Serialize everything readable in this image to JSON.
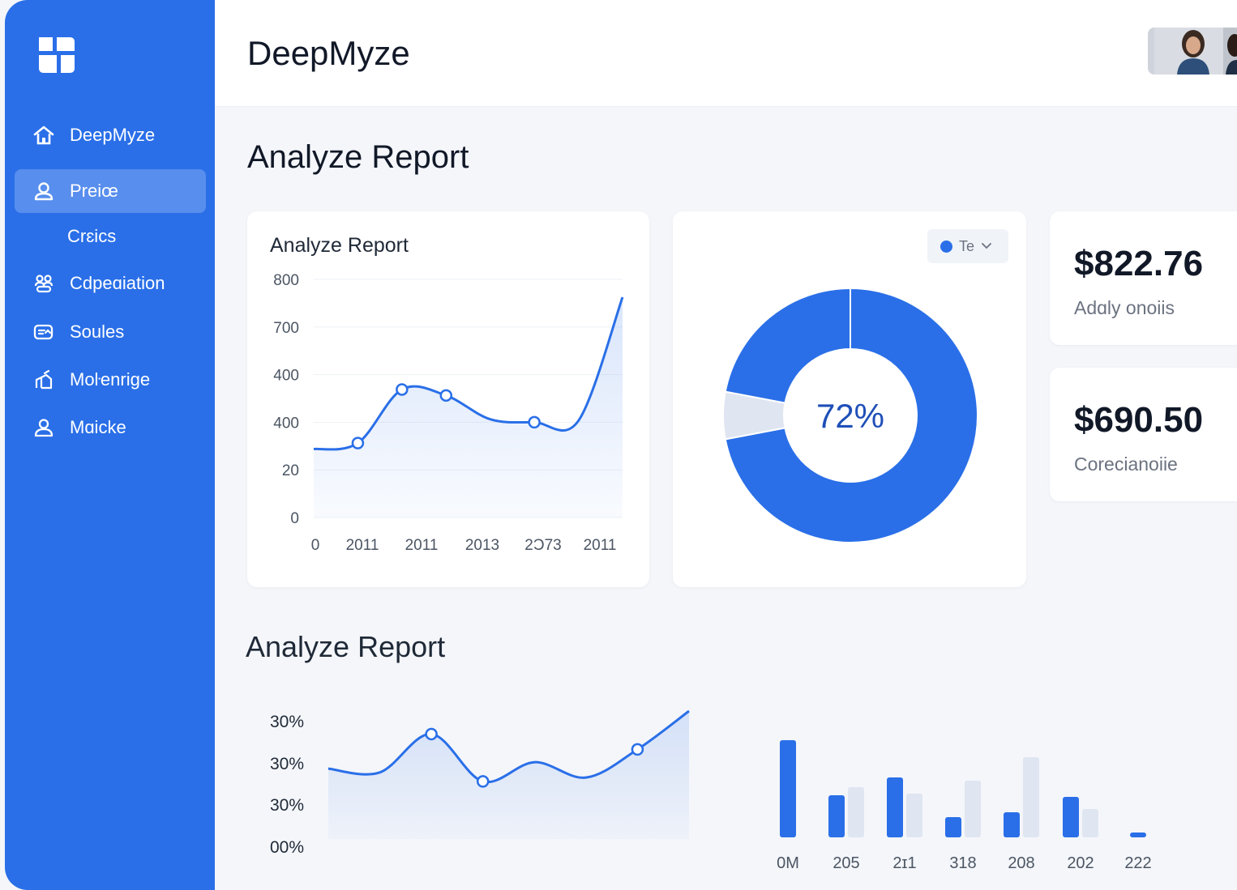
{
  "app": {
    "title": "DeepMyze"
  },
  "sidebar": {
    "items": [
      {
        "label": "DeepMyze",
        "icon": "home-icon"
      },
      {
        "label": "Preiœ",
        "icon": "user-icon",
        "active": true
      },
      {
        "label": "Crɛics",
        "icon": "",
        "sub": true
      },
      {
        "label": "Cdpeɑiation",
        "icon": "collaboration-icon"
      },
      {
        "label": "Soules",
        "icon": "sales-icon"
      },
      {
        "label": "Moŀenrige",
        "icon": "marketing-icon"
      },
      {
        "label": "Mɑicke",
        "icon": "profile-icon"
      }
    ]
  },
  "page": {
    "title": "Analyze Report"
  },
  "line_card": {
    "title": "Analyze Report"
  },
  "donut_card": {
    "select_label": "Te",
    "center_label": "72%"
  },
  "stats": [
    {
      "value": "$822.76",
      "label": "Adɑly onoiis"
    },
    {
      "value": "$690.50",
      "label": "Corecianoiie"
    }
  ],
  "section2": {
    "title": "Analyze Report"
  },
  "colors": {
    "accent": "#2a6fe8",
    "secondary": "#dfe5f1"
  },
  "chart_data": [
    {
      "type": "line",
      "title": "Analyze Report",
      "x": [
        "0",
        "2011",
        "2011",
        "2013",
        "2Ɔ73",
        "2011"
      ],
      "yticks": [
        "800",
        "700",
        "400",
        "400",
        "20",
        "0"
      ],
      "series": [
        {
          "values": [
            230,
            250,
            430,
            410,
            330,
            320,
            325,
            740
          ]
        }
      ],
      "markers": [
        1,
        2,
        3,
        5
      ],
      "grid": true,
      "area_fill": true
    },
    {
      "type": "pie",
      "subtype": "donut",
      "values": [
        72,
        6,
        22
      ],
      "labels": [
        "72%"
      ]
    },
    {
      "type": "line",
      "yticks": [
        "30%",
        "30%",
        "30%",
        "00%"
      ],
      "series": [
        {
          "values": [
            0.55,
            0.52,
            0.82,
            0.45,
            0.6,
            0.48,
            0.7,
            1.0
          ]
        }
      ],
      "area_fill": true
    },
    {
      "type": "bar",
      "categories": [
        "0M",
        "205",
        "2ɪ1",
        "318",
        "208",
        "202",
        "222"
      ],
      "series": [
        {
          "values": [
            120,
            52,
            74,
            25,
            31,
            50,
            6
          ]
        },
        {
          "values": [
            0,
            62,
            54,
            70,
            99,
            35,
            0
          ]
        }
      ]
    }
  ]
}
